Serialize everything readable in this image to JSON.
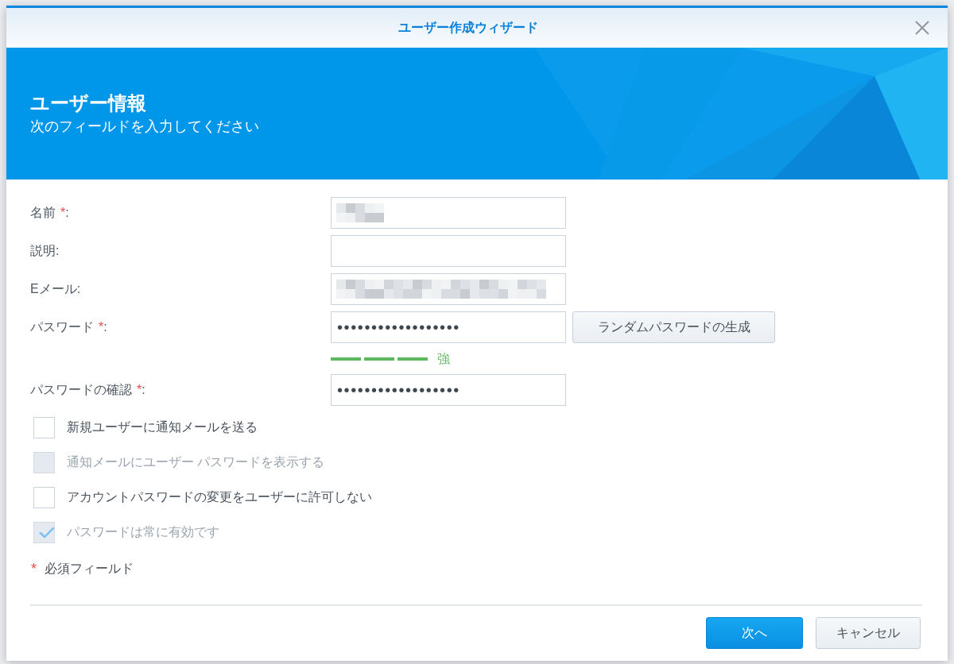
{
  "dialog": {
    "title": "ユーザー作成ウィザード"
  },
  "banner": {
    "title": "ユーザー情報",
    "subtitle": "次のフィールドを入力してください"
  },
  "fields": [
    {
      "label": "名前",
      "required_mark": "*",
      "suffix": ":",
      "kind": "blurred",
      "blur_wide": false
    },
    {
      "label": "説明",
      "suffix": ":",
      "kind": "text"
    },
    {
      "label": "Eメール",
      "suffix": ":",
      "kind": "blurred",
      "blur_wide": true
    },
    {
      "label": "パスワード",
      "required_mark": "*",
      "suffix": ":",
      "kind": "password",
      "value": "••••••••••••••••••",
      "button": "ランダムパスワードの生成",
      "strength": {
        "level": 1,
        "label": "強"
      }
    },
    {
      "label": "パスワードの確認",
      "required_mark": "*",
      "suffix": ":",
      "kind": "password",
      "value": "••••••••••••••••••"
    }
  ],
  "checkboxes": [
    {
      "label": "新規ユーザーに通知メールを送る",
      "checked": false,
      "disabled": false
    },
    {
      "label": "通知メールにユーザー パスワードを表示する",
      "checked": false,
      "disabled": true
    },
    {
      "label": "アカウントパスワードの変更をユーザーに許可しない",
      "checked": false,
      "disabled": false
    },
    {
      "label": "パスワードは常に有効です",
      "checked": true,
      "disabled": true
    }
  ],
  "required_note": {
    "mark": "*",
    "text": "必須フィールド"
  },
  "buttons": [
    {
      "label": "次へ",
      "kind": "primary"
    },
    {
      "label": "キャンセル",
      "kind": "secondary"
    }
  ]
}
